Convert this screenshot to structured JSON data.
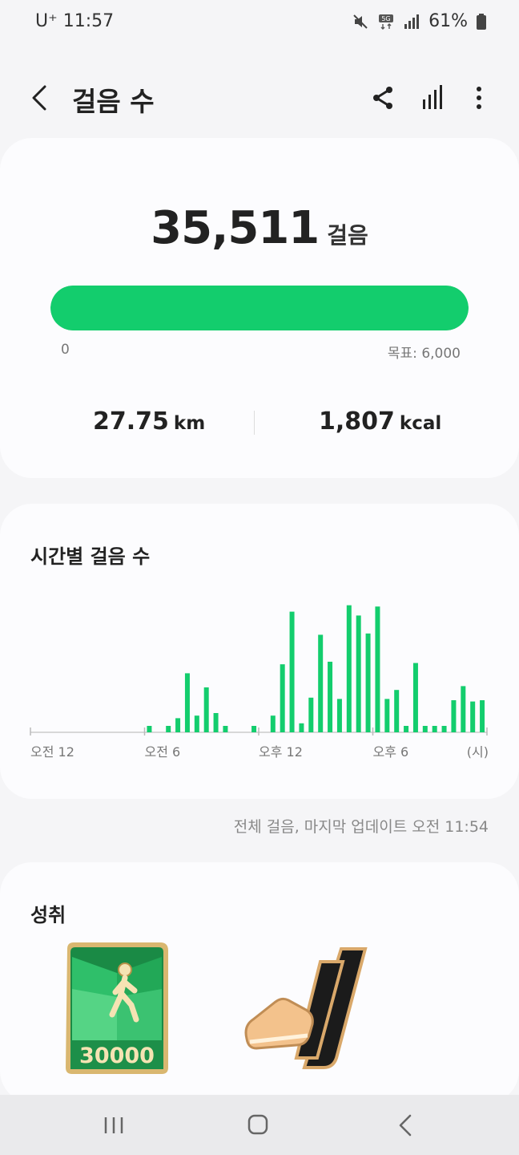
{
  "status": {
    "carrier": "U⁺ 11:57",
    "battery": "61%"
  },
  "header": {
    "title": "걸음 수",
    "icons": [
      "back-icon",
      "share-icon",
      "chart-icon",
      "more-icon"
    ]
  },
  "summary": {
    "steps": "35,511",
    "steps_unit": "걸음",
    "progress_min": "0",
    "goal_label": "목표: 6,000",
    "progress_fraction": 1.0,
    "distance_value": "27.75",
    "distance_unit": "km",
    "calories_value": "1,807",
    "calories_unit": "kcal",
    "accent": "#13cd6d"
  },
  "hourly": {
    "title": "시간별 걸음 수",
    "chart_data": {
      "type": "bar",
      "categories": [
        "0",
        "1",
        "2",
        "3",
        "4",
        "5",
        "6",
        "7",
        "8",
        "9",
        "10",
        "11",
        "12",
        "13",
        "14",
        "15",
        "16",
        "17",
        "18",
        "19",
        "20",
        "21",
        "22",
        "23"
      ],
      "series_halfhour_relative": [
        0,
        0,
        0,
        0,
        0,
        0,
        0,
        0,
        0,
        0,
        0,
        0,
        0.05,
        0,
        0.05,
        0.11,
        0.46,
        0.13,
        0.35,
        0.15,
        0.05,
        0,
        0,
        0.05,
        0,
        0.13,
        0.53,
        0.94,
        0.07,
        0.27,
        0.76,
        0.55,
        0.26,
        0.99,
        0.91,
        0.77,
        0.98,
        0.26,
        0.33,
        0.05,
        0.54,
        0.05,
        0.05,
        0.05,
        0.25,
        0.36,
        0.24,
        0.25
      ],
      "xtick_labels": [
        "오전 12",
        "오전 6",
        "오후 12",
        "오후 6",
        "(시)"
      ],
      "ylim": [
        0,
        1
      ],
      "color": "#13cd6d"
    }
  },
  "update_note": "전체 걸음, 마지막 업데이트 오전 11:54",
  "achievements": {
    "title": "성취",
    "badges": [
      {
        "name": "walker-badge",
        "label": "30000"
      },
      {
        "name": "shoe-badge"
      }
    ]
  },
  "navbar": {
    "icons": [
      "recent-apps-icon",
      "home-icon",
      "back-nav-icon"
    ]
  }
}
